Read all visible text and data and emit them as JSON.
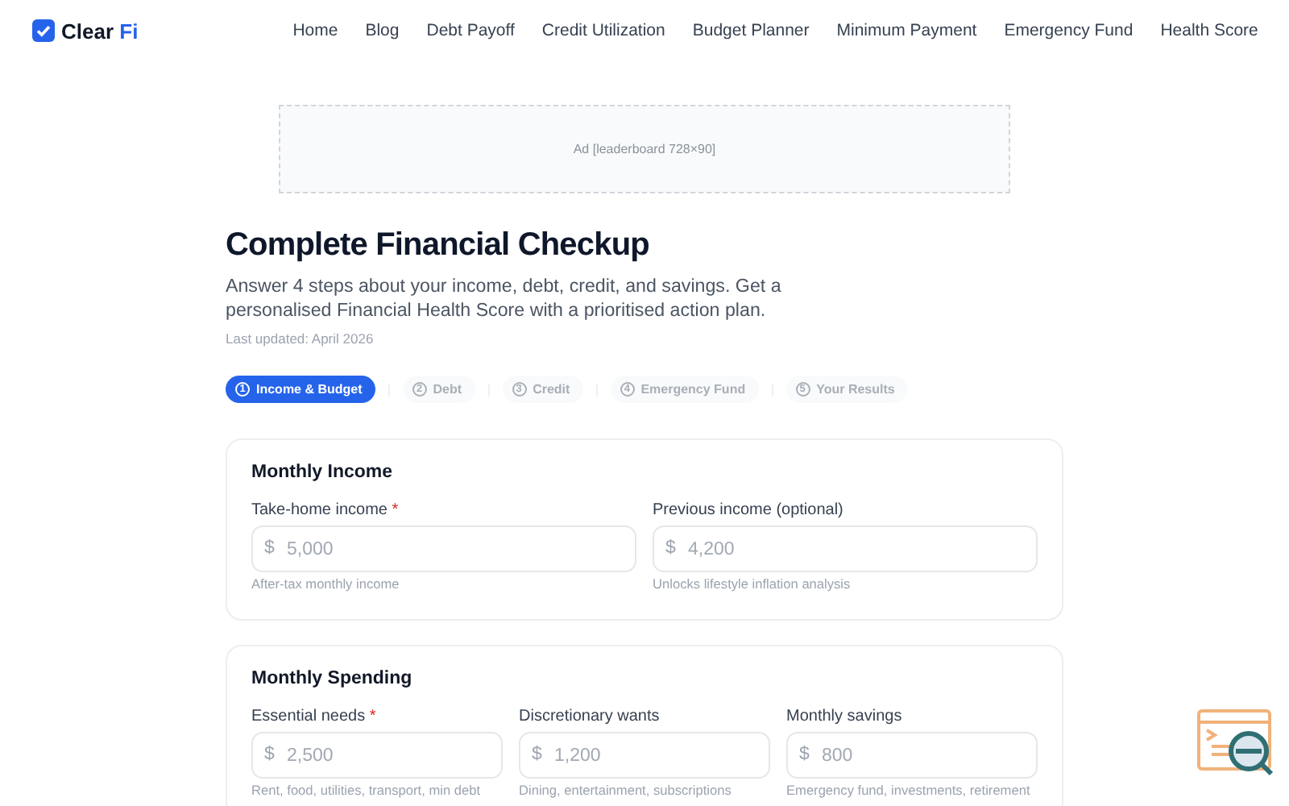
{
  "header": {
    "logo": {
      "text": "Clear",
      "accent": "Fi"
    },
    "nav": [
      "Home",
      "Blog",
      "Debt Payoff",
      "Credit Utilization",
      "Budget Planner",
      "Minimum Payment",
      "Emergency Fund",
      "Health Score"
    ]
  },
  "ad": {
    "text": "Ad [leaderboard 728×90]"
  },
  "title": "Complete Financial Checkup",
  "intro": "Answer 4 steps about your income, debt, credit, and savings. Get a personalised Financial Health Score with a prioritised action plan.",
  "updated": "Last updated: April 2026",
  "steps": [
    {
      "number": "1",
      "label": "Income & Budget",
      "selected": true
    },
    {
      "number": "2",
      "label": "Debt",
      "selected": false
    },
    {
      "number": "3",
      "label": "Credit",
      "selected": false
    },
    {
      "number": "4",
      "label": "Emergency Fund",
      "selected": false
    },
    {
      "number": "5",
      "label": "Your Results",
      "selected": false
    }
  ],
  "required_symbol": "*",
  "cards": [
    {
      "title": "Monthly Income",
      "fields": [
        {
          "label": "Take-home income",
          "required": true,
          "prefix": "$",
          "placeholder": "5,000",
          "hint": "After-tax monthly income"
        },
        {
          "label": "Previous income (optional)",
          "required": false,
          "prefix": "$",
          "placeholder": "4,200",
          "hint": "Unlocks lifestyle inflation analysis"
        }
      ]
    },
    {
      "title": "Monthly Spending",
      "fields": [
        {
          "label": "Essential needs",
          "required": true,
          "prefix": "$",
          "placeholder": "2,500",
          "hint": "Rent, food, utilities, transport, min debt"
        },
        {
          "label": "Discretionary wants",
          "required": false,
          "prefix": "$",
          "placeholder": "1,200",
          "hint": "Dining, entertainment, subscriptions"
        },
        {
          "label": "Monthly savings",
          "required": false,
          "prefix": "$",
          "placeholder": "800",
          "hint": "Emergency fund, investments, retirement"
        }
      ]
    }
  ]
}
